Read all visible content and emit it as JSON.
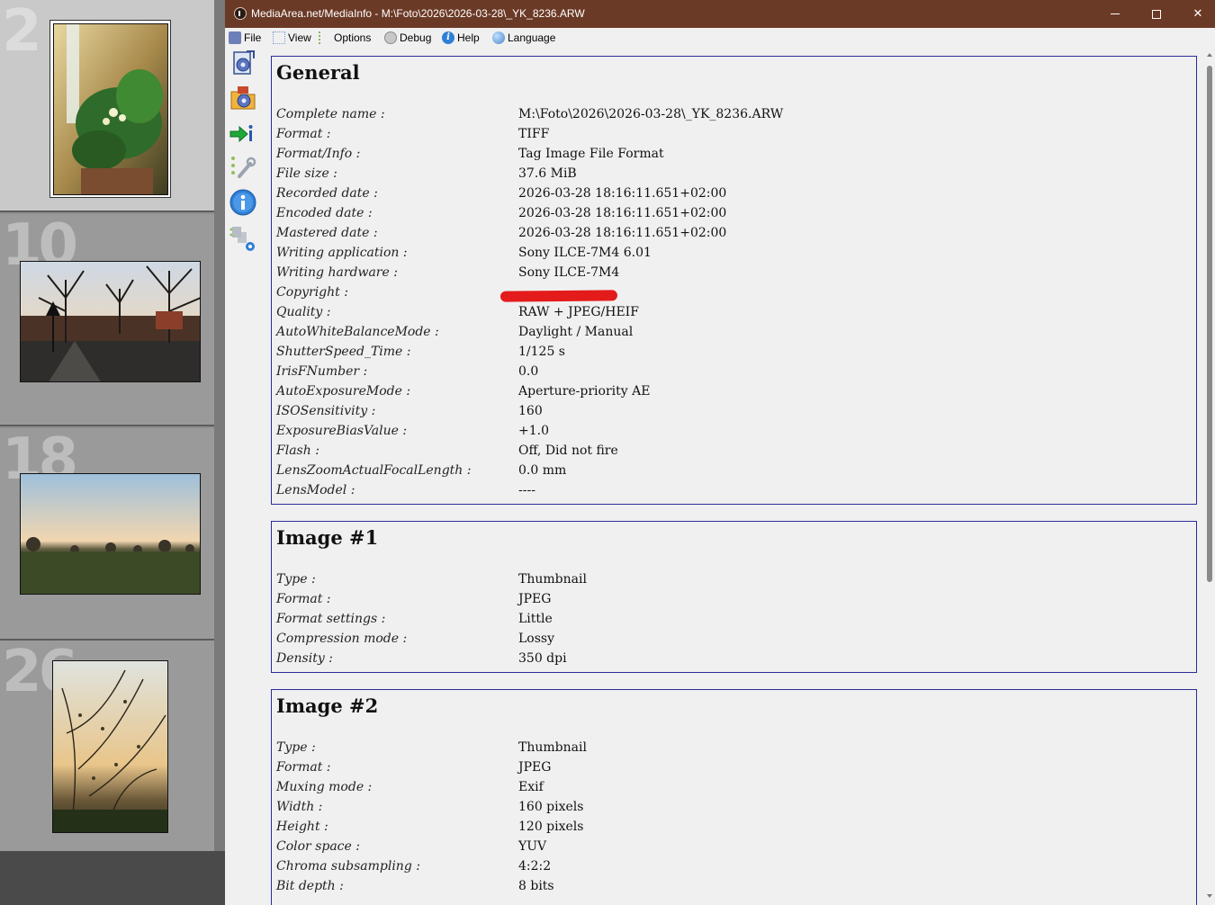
{
  "filmstrip": {
    "frames": [
      {
        "number": "2",
        "selected": true
      },
      {
        "number": "10",
        "selected": false
      },
      {
        "number": "18",
        "selected": false
      },
      {
        "number": "26",
        "selected": false
      }
    ]
  },
  "window": {
    "title": "MediaArea.net/MediaInfo - M:\\Foto\\2026\\2026-03-28\\_YK_8236.ARW",
    "controls": {
      "minimize": "—",
      "maximize": "☐",
      "close": "✕"
    },
    "menu": {
      "file": "File",
      "view": "View",
      "options": "Options",
      "debug": "Debug",
      "help": "Help",
      "language": "Language"
    },
    "toolbar_icons": [
      "open-file-icon",
      "open-folder-icon",
      "export-icon",
      "settings-icon",
      "about-icon",
      "file-list-icon"
    ]
  },
  "sections": {
    "general": {
      "title": "General",
      "rows": [
        {
          "key": "Complete name :",
          "value": "M:\\Foto\\2026\\2026-03-28\\_YK_8236.ARW"
        },
        {
          "key": "Format :",
          "value": "TIFF"
        },
        {
          "key": "Format/Info :",
          "value": "Tag Image File Format"
        },
        {
          "key": "File size :",
          "value": "37.6 MiB"
        },
        {
          "key": "Recorded date :",
          "value": "2026-03-28 18:16:11.651+02:00"
        },
        {
          "key": "Encoded date :",
          "value": "2026-03-28 18:16:11.651+02:00"
        },
        {
          "key": "Mastered date :",
          "value": "2026-03-28 18:16:11.651+02:00"
        },
        {
          "key": "Writing application :",
          "value": "Sony ILCE-7M4 6.01"
        },
        {
          "key": "Writing hardware :",
          "value": "Sony ILCE-7M4"
        },
        {
          "key": "Copyright :",
          "value": ""
        },
        {
          "key": "Quality :",
          "value": "RAW + JPEG/HEIF"
        },
        {
          "key": "AutoWhiteBalanceMode :",
          "value": "Daylight / Manual"
        },
        {
          "key": "ShutterSpeed_Time :",
          "value": "1/125 s"
        },
        {
          "key": "IrisFNumber :",
          "value": "0.0"
        },
        {
          "key": "AutoExposureMode :",
          "value": "Aperture-priority AE"
        },
        {
          "key": "ISOSensitivity :",
          "value": "160"
        },
        {
          "key": "ExposureBiasValue :",
          "value": "+1.0"
        },
        {
          "key": "Flash :",
          "value": "Off, Did not fire"
        },
        {
          "key": "LensZoomActualFocalLength :",
          "value": "0.0 mm"
        },
        {
          "key": "LensModel :",
          "value": "----"
        }
      ]
    },
    "image1": {
      "title": "Image #1",
      "rows": [
        {
          "key": "Type :",
          "value": "Thumbnail"
        },
        {
          "key": "Format :",
          "value": "JPEG"
        },
        {
          "key": "Format settings :",
          "value": "Little"
        },
        {
          "key": "Compression mode :",
          "value": "Lossy"
        },
        {
          "key": "Density :",
          "value": "350 dpi"
        }
      ]
    },
    "image2": {
      "title": "Image #2",
      "rows": [
        {
          "key": "Type :",
          "value": "Thumbnail"
        },
        {
          "key": "Format :",
          "value": "JPEG"
        },
        {
          "key": "Muxing mode :",
          "value": "Exif"
        },
        {
          "key": "Width :",
          "value": "160 pixels"
        },
        {
          "key": "Height :",
          "value": "120 pixels"
        },
        {
          "key": "Color space :",
          "value": "YUV"
        },
        {
          "key": "Chroma subsampling :",
          "value": "4:2:2"
        },
        {
          "key": "Bit depth :",
          "value": "8 bits"
        }
      ]
    }
  },
  "colors": {
    "titlebar": "#6b3a26",
    "section_border": "#2b2b9a",
    "redaction": "#e41b1b"
  }
}
